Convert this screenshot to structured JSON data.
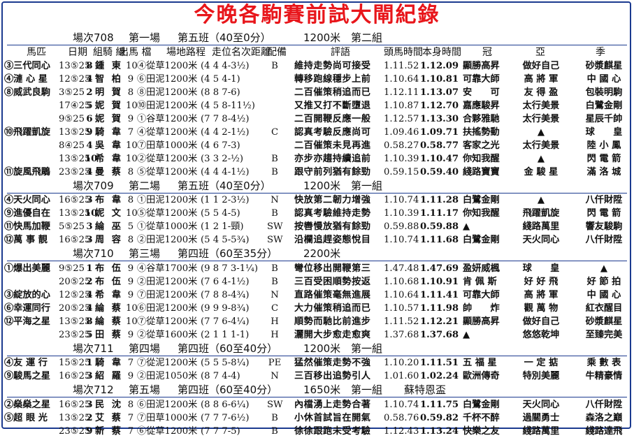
{
  "title": "今晚各駒賽前試大閘紀錄",
  "headers": {
    "name": "馬匹",
    "date": "日期",
    "gate": "組",
    "jockey": "騎 練",
    "draw": "出馬 檔",
    "track": "場地路程",
    "pos": "走位名次距離",
    "equip": "配備",
    "comment": "評語",
    "leader_time": "頭馬時間",
    "own_time": "本身時間",
    "first": "冠",
    "second": "亞",
    "third": "季"
  },
  "sections": [
    {
      "race": "場次708",
      "field": "第一場",
      "cls": "第五班（40至0分）",
      "dist": "1200米",
      "grp": "第二組",
      "extra": "",
      "rows": [
        {
          "name": "③三代同心",
          "date": "13⑤25",
          "gate": "8",
          "jockey": "鍾 東",
          "wt": "10",
          "track": "④從草1200米",
          "pos": "(4 4 4-3½)",
          "eq": "B",
          "com": "維持走勢尚可接受",
          "ldr": "1.11.52",
          "own": "1.12.09",
          "w1": "顯勝高昇",
          "w2": "做好自己",
          "w3": "砂漿麒星"
        },
        {
          "name": "④漣 心 星",
          "date": "12⑤25",
          "gate": "4",
          "jockey": "智 柏",
          "wt": "9",
          "track": "⑥田泥1200米",
          "pos": "(4 5 4-1)",
          "eq": "",
          "com": "轉移跑線穩步上前",
          "ldr": "1.10.64",
          "own": "1.10.81",
          "w1": "可靠大師",
          "w2": "高 將 軍",
          "w3": "中 國 心"
        },
        {
          "name": "⑧威武良駒",
          "date": "3⑤25",
          "gate": "2",
          "jockey": "明 賀",
          "wt": "8",
          "track": "⑧田泥1200米",
          "pos": "(8 8 7-6)",
          "eq": "",
          "com": "二百催策稍追而已",
          "ldr": "1.12.11",
          "own": "1.13.07",
          "w1": "安　　可",
          "w2": "友 得 盈",
          "w3": "包裝明駒"
        },
        {
          "name": "",
          "date": "17④25",
          "gate": "5",
          "jockey": "妮 賀",
          "wt": "10",
          "track": "⑩田泥1200米",
          "pos": "(4 5 8-11½)",
          "eq": "",
          "com": "又推又打不斷墮退",
          "ldr": "1.10.87",
          "own": "1.12.70",
          "w1": "嘉應駿昇",
          "w2": "太行美景",
          "w3": "白鷺金剛"
        },
        {
          "name": "",
          "date": "9⑤25",
          "gate": "6",
          "jockey": "妮 賀",
          "wt": "9",
          "track": "①谷草1200米",
          "pos": "(7 7 8-4½)",
          "eq": "",
          "com": "二百開鞭反應一般",
          "ldr": "1.12.57",
          "own": "1.13.30",
          "w1": "合夥雅馳",
          "w2": "太行美景",
          "w3": "星辰千帥"
        },
        {
          "name": "⑩飛躍凱旋",
          "date": "13⑤25",
          "gate": "9",
          "jockey": "騎 韋",
          "wt": "7",
          "track": "④從草1200米",
          "pos": "(4 4 2-1½)",
          "eq": "C",
          "com": "認真考驗反應尚可",
          "ldr": "1.09.46",
          "own": "1.09.71",
          "w1": "扶搖勢動",
          "w2": "▲",
          "w3": "球　　皇"
        },
        {
          "name": "",
          "date": "8④25",
          "gate": "4",
          "jockey": "吳 韋",
          "wt": "10",
          "track": "⑦田草1000米",
          "pos": "(4 6 7-3)",
          "eq": "",
          "com": "二百催策未見再進",
          "ldr": "0.58.27",
          "own": "0.58.77",
          "w1": "客家之光",
          "w2": "太行美景",
          "w3": "陸 小 鳳"
        },
        {
          "name": "",
          "date": "13⑤25",
          "gate": "10",
          "jockey": "希 韋",
          "wt": "10",
          "track": "②從草1200米",
          "pos": "(3 3 2-½)",
          "eq": "B",
          "com": "亦步亦趨持續追前",
          "ldr": "1.10.39",
          "own": "1.10.47",
          "w1": "你知我醒",
          "w2": "▲",
          "w3": "閃 電 箭"
        },
        {
          "name": "⑪旋風飛鵰",
          "date": "23⑤25",
          "gate": "4",
          "jockey": "曼 蔡",
          "wt": "8",
          "track": "⑤從草1200米",
          "pos": "(4 4 4-1½)",
          "eq": "B",
          "com": "跟守前列猶有餘勁",
          "ldr": "0.59.15",
          "own": "0.59.40",
          "w1": "綫路寶寶",
          "w2": "金 駿 星",
          "w3": "滿 洛 城"
        }
      ]
    },
    {
      "race": "場次709",
      "field": "第二場",
      "cls": "第五班（40至0分）",
      "dist": "1200米",
      "grp": "第一組",
      "extra": "",
      "rows": [
        {
          "name": "④天火同心",
          "date": "16⑤25",
          "gate": "3",
          "jockey": "布 韋",
          "wt": "8",
          "track": "①田泥1200米",
          "pos": "(1 1 2-3½)",
          "eq": "N",
          "com": "快放第二韌力增強",
          "ldr": "1.10.74",
          "own": "1.11.28",
          "w1": "白鷺金剛",
          "w2": "▲",
          "w3": "八仟財陞"
        },
        {
          "name": "⑨進優自在",
          "date": "13⑤25",
          "gate": "10",
          "jockey": "妮 文",
          "wt": "10",
          "track": "⑤從草1200米",
          "pos": "(5 5 4-5)",
          "eq": "B",
          "com": "認真考驗維持走勢",
          "ldr": "1.10.39",
          "own": "1.11.17",
          "w1": "你知我醒",
          "w2": "飛躍凱旋",
          "w3": "閃 電 箭"
        },
        {
          "name": "⑪快馬加鞭",
          "date": "5⑤25",
          "gate": "3",
          "jockey": "綸 巫",
          "wt": "5",
          "track": "①從草1000米",
          "pos": "(1 2 1-頸)",
          "eq": "SW",
          "com": "按轡慢放猶有餘勁",
          "ldr": "0.59.88",
          "own": "0.59.88",
          "w1": "▲",
          "w2": "綫路萬里",
          "w3": "響友駿駒"
        },
        {
          "name": "⑫萬 事 靚",
          "date": "16⑤25",
          "gate": "3",
          "jockey": "周 容",
          "wt": "8",
          "track": "②田泥1200米",
          "pos": "(5 4 5-5¾)",
          "eq": "SW",
          "com": "沿欄追趕姿態悅目",
          "ldr": "1.10.74",
          "own": "1.11.68",
          "w1": "白鷺金剛",
          "w2": "天火同心",
          "w3": "八仟財陞"
        }
      ]
    },
    {
      "race": "場次710",
      "field": "第三場",
      "cls": "第四班（60至35分）",
      "dist": "2200米",
      "grp": "",
      "extra": "",
      "rows": [
        {
          "name": "①爆出美麗",
          "date": "9⑤25",
          "gate": "1",
          "jockey": "布 伍",
          "wt": "9",
          "track": "④谷草1700米",
          "pos": "(9 8 7 3-1¼)",
          "eq": "B",
          "com": "彎位移出開鞭第三",
          "ldr": "1.47.48",
          "own": "1.47.69",
          "w1": "盈妍威楓",
          "w2": "球　　皇",
          "w3": "▲"
        },
        {
          "name": "",
          "date": "20⑤25",
          "gate": "2",
          "jockey": "布 伍",
          "wt": "9",
          "track": "②田泥1200米",
          "pos": "(7 6 4-1½)",
          "eq": "B",
          "com": "三百受困順勢按返",
          "ldr": "1.10.68",
          "own": "1.10.91",
          "w1": "肯 佩 斯",
          "w2": "好 好 飛",
          "w3": "好 節 拍"
        },
        {
          "name": "③綻放的心",
          "date": "12⑤25",
          "gate": "4",
          "jockey": "希 韋",
          "wt": "9",
          "track": "⑦田泥1200米",
          "pos": "(7 8 8-4¾)",
          "eq": "N",
          "com": "直路催策毫無進展",
          "ldr": "1.10.64",
          "own": "1.11.41",
          "w1": "可靠大師",
          "w2": "高 將 軍",
          "w3": "中 國 心"
        },
        {
          "name": "⑥幸運同行",
          "date": "20⑤25",
          "gate": "4",
          "jockey": "綸 蔡",
          "wt": "10",
          "track": "⑥田泥1200米",
          "pos": "(9 9 9-8¾)",
          "eq": "C",
          "com": "大力催策稍追而已",
          "ldr": "1.10.57",
          "own": "1.11.98",
          "w1": "帥　　炸",
          "w2": "觀 萬 物",
          "w3": "紅衣醒目"
        },
        {
          "name": "⑫平海之星",
          "date": "13⑤25",
          "gate": "8",
          "jockey": "綸 蔡",
          "wt": "10",
          "track": "⑦從草1200米",
          "pos": "(7 7 6-4¼)",
          "eq": "H",
          "com": "順勢而馳比前進步",
          "ldr": "1.11.52",
          "own": "1.12.21",
          "w1": "顯勝高昇",
          "w2": "做好自己",
          "w3": "砂漿麒星"
        },
        {
          "name": "",
          "date": "23⑤25",
          "gate": "5",
          "jockey": "田 蔡",
          "wt": "9",
          "track": "②從草1600米",
          "pos": "(2 1 1 1-1)",
          "eq": "H",
          "com": "灑開大步愈走愈爽",
          "ldr": "1.37.68",
          "own": "1.37.68",
          "w1": "▲",
          "w2": "悠悠乾坤",
          "w3": "至臻完美"
        }
      ]
    },
    {
      "race": "場次711",
      "field": "第四場",
      "cls": "第四班（60至40分）",
      "dist": "1200米",
      "grp": "第一組",
      "extra": "",
      "rows": [
        {
          "name": "④友 運 行",
          "date": "15⑤25",
          "gate": "1",
          "jockey": "騎 韋",
          "wt": "7",
          "track": "⑦從泥1200米",
          "pos": "(5 5 5-8¼)",
          "eq": "PE",
          "com": "猛然催策走勢不強",
          "ldr": "1.10.20",
          "own": "1.11.51",
          "w1": "五 福 星",
          "w2": "一 定 掂",
          "w3": "乘 數 表"
        },
        {
          "name": "⑨駿馬之星",
          "date": "16⑤25",
          "gate": "3",
          "jockey": "紹 羅",
          "wt": "9",
          "track": "②田泥1050米",
          "pos": "(8 7 4-4)",
          "eq": "N",
          "com": "三百移出追勢引人",
          "ldr": "1.01.60",
          "own": "1.02.24",
          "w1": "歐洲傳奇",
          "w2": "特別美麗",
          "w3": "牛精豪情"
        }
      ]
    },
    {
      "race": "場次712",
      "field": "第五場",
      "cls": "第四班（60至40分）",
      "dist": "1650米",
      "grp": "第一組",
      "extra": "蘇特恩盃",
      "rows": [
        {
          "name": "②燊燊之星",
          "date": "16⑤25",
          "gate": "3",
          "jockey": "民 沈",
          "wt": "8",
          "track": "⑥田泥1200米",
          "pos": "(8 8 6-6¼)",
          "eq": "SW",
          "com": "內檔湧上走勢合著",
          "ldr": "1.10.74",
          "own": "1.11.75",
          "w1": "白鷺金剛",
          "w2": "天火同心",
          "w3": "八仟財陞"
        },
        {
          "name": "⑤超 眼 光",
          "date": "13⑤25",
          "gate": "2",
          "jockey": "艾 蔡",
          "wt": "7",
          "track": "⑦田草1000米",
          "pos": "(7 7 7-6½)",
          "eq": "B",
          "com": "小休首試旨在開氣",
          "ldr": "0.58.76",
          "own": "0.59.82",
          "w1": "千杯不醉",
          "w2": "過關勇士",
          "w3": "森洛之巔"
        },
        {
          "name": "",
          "date": "23⑤25",
          "gate": "9",
          "jockey": "新 蔡",
          "wt": "7",
          "track": "⑥從草1200米",
          "pos": "(7 7 7-5)",
          "eq": "B",
          "com": "徐徐跟跑未受考驗",
          "ldr": "1.12.43",
          "own": "1.13.24",
          "w1": "快樂之友",
          "w2": "綫路萬里",
          "w3": "綫路達飛"
        }
      ]
    }
  ],
  "colors": {
    "title": "#e8161b",
    "border": "#1b3a8f",
    "text": "#111111"
  }
}
